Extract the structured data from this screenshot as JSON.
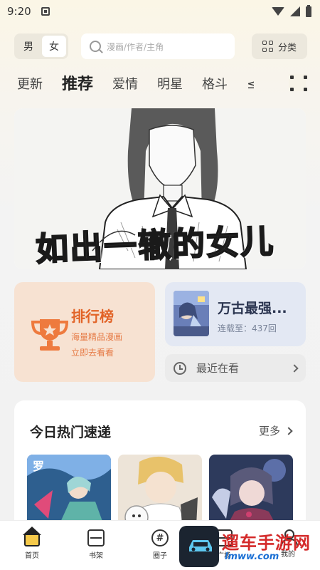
{
  "status_bar": {
    "time": "9:20"
  },
  "header": {
    "gender_options": [
      "男",
      "女"
    ],
    "gender_selected": "女",
    "search_placeholder": "漫画/作者/主角",
    "category_label": "分类"
  },
  "tabs": [
    {
      "label": "更新",
      "active": false
    },
    {
      "label": "推荐",
      "active": true
    },
    {
      "label": "爱情",
      "active": false
    },
    {
      "label": "明星",
      "active": false
    },
    {
      "label": "格斗",
      "active": false
    },
    {
      "label": "≤",
      "active": false
    }
  ],
  "banner": {
    "title": "如出一辙的女儿"
  },
  "ranking_card": {
    "title": "排行榜",
    "subtitle_1": "海量精品漫画",
    "subtitle_2": "立即去看看",
    "icon": "trophy-icon"
  },
  "continue_card": {
    "title": "万古最强...",
    "progress_text": "连载至：437回"
  },
  "recent_card": {
    "label": "最近在看",
    "icon": "clock-icon"
  },
  "hot_section": {
    "title": "今日热门速递",
    "more_label": "更多"
  },
  "bottom_nav": [
    {
      "label": "首页",
      "icon": "home-icon",
      "active": true
    },
    {
      "label": "书架",
      "icon": "bookshelf-icon",
      "active": false
    },
    {
      "label": "圈子",
      "icon": "hashtag-icon",
      "active": false
    },
    {
      "label": "广场",
      "icon": "plaza-icon",
      "active": false
    },
    {
      "label": "我的",
      "icon": "user-icon",
      "active": false
    }
  ],
  "watermark": {
    "text": "遛车手游网",
    "url": "lmww.com"
  },
  "colors": {
    "accent_orange": "#e26428",
    "rank_card_bg": "#f7e2d2",
    "continue_card_bg": "#e3e8f3",
    "home_active": "#f5c94a"
  }
}
